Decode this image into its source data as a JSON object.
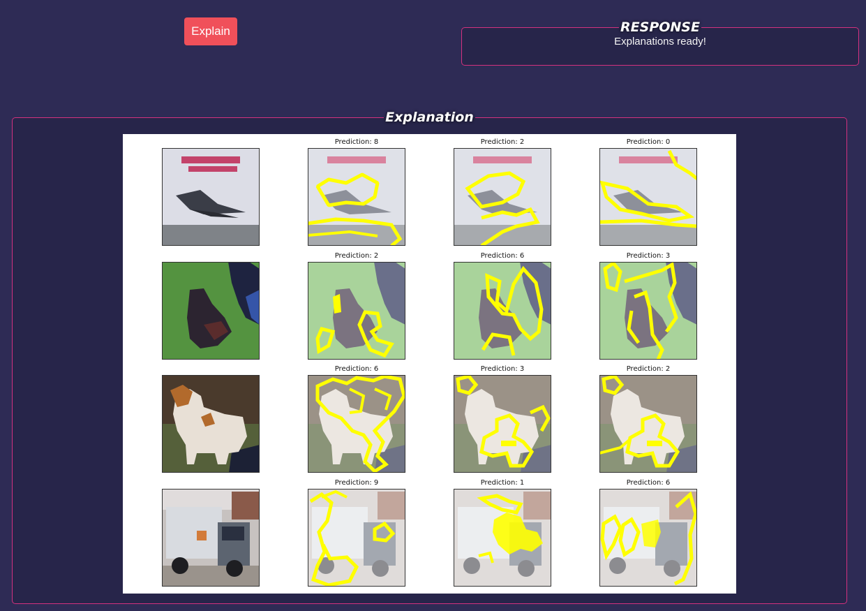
{
  "toolbar": {
    "explain_label": "Explain"
  },
  "response": {
    "title": "RESPONSE",
    "message": "Explanations ready!"
  },
  "explanation": {
    "title": "Explanation",
    "rows": [
      {
        "original": "airplane",
        "predictions": [
          "Prediction: 8",
          "Prediction: 2",
          "Prediction: 0"
        ]
      },
      {
        "original": "bird",
        "predictions": [
          "Prediction: 2",
          "Prediction: 6",
          "Prediction: 3"
        ]
      },
      {
        "original": "dog",
        "predictions": [
          "Prediction: 6",
          "Prediction: 3",
          "Prediction: 2"
        ]
      },
      {
        "original": "truck",
        "predictions": [
          "Prediction: 9",
          "Prediction: 1",
          "Prediction: 6"
        ]
      }
    ]
  },
  "colors": {
    "background": "#2e2b55",
    "panel": "#27254a",
    "border": "#d4317f",
    "button": "#f0505a",
    "boundary": "#ffff00"
  }
}
